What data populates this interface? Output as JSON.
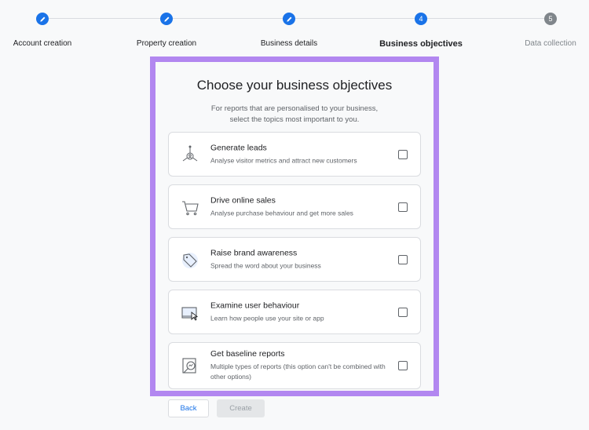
{
  "stepper": {
    "steps": [
      {
        "label": "Account creation",
        "state": "done",
        "icon": "pencil-icon"
      },
      {
        "label": "Property creation",
        "state": "done",
        "icon": "pencil-icon"
      },
      {
        "label": "Business details",
        "state": "done",
        "icon": "pencil-icon"
      },
      {
        "label": "Business objectives",
        "state": "active",
        "number": "4"
      },
      {
        "label": "Data collection",
        "state": "todo",
        "number": "5"
      }
    ]
  },
  "main": {
    "title": "Choose your business objectives",
    "subtitle_line1": "For reports that are personalised to your business,",
    "subtitle_line2": "select the topics most important to you.",
    "objectives": [
      {
        "title": "Generate leads",
        "description": "Analyse visitor metrics and attract new customers",
        "icon": "leads-icon",
        "checked": false
      },
      {
        "title": "Drive online sales",
        "description": "Analyse purchase behaviour and get more sales",
        "icon": "shopping-cart-icon",
        "checked": false
      },
      {
        "title": "Raise brand awareness",
        "description": "Spread the word about your business",
        "icon": "tag-icon",
        "checked": false
      },
      {
        "title": "Examine user behaviour",
        "description": "Learn how people use your site or app",
        "icon": "monitor-cursor-icon",
        "checked": false
      },
      {
        "title": "Get baseline reports",
        "description": "Multiple types of reports (this option can't be combined with other options)",
        "icon": "magnifier-report-icon",
        "checked": false
      }
    ]
  },
  "footer": {
    "back_label": "Back",
    "create_label": "Create"
  },
  "colors": {
    "accent": "#1a73e8",
    "highlight_border": "#b287f0",
    "disabled_bg": "#e4e6e8"
  }
}
